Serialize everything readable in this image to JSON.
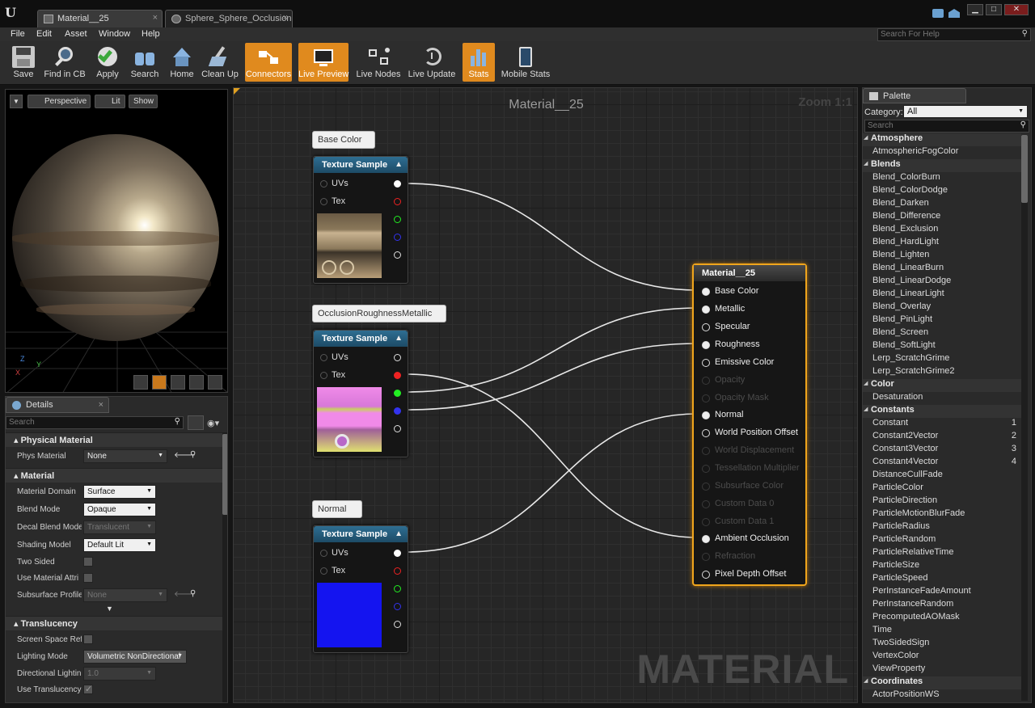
{
  "window": {
    "tabs": [
      {
        "label": "Material__25",
        "close": "×"
      },
      {
        "label": "Sphere_Sphere_OcclusionR",
        "close": "×"
      }
    ],
    "buttons": {
      "minimize": "▁",
      "maximize": "□",
      "close": "✕"
    },
    "logo": "U"
  },
  "menu": {
    "items": [
      "File",
      "Edit",
      "Asset",
      "Window",
      "Help"
    ],
    "search_placeholder": "Search For Help"
  },
  "toolbar": {
    "buttons": [
      {
        "label": "Save",
        "icon": "save-icon",
        "active": false
      },
      {
        "label": "Find in CB",
        "icon": "magnifier-icon",
        "active": false
      },
      {
        "label": "Apply",
        "icon": "checkmark-icon",
        "active": false
      },
      {
        "label": "Search",
        "icon": "binoculars-icon",
        "active": false
      },
      {
        "label": "Home",
        "icon": "home-icon",
        "active": false
      },
      {
        "label": "Clean Up",
        "icon": "broom-icon",
        "active": false
      },
      {
        "label": "Connectors",
        "icon": "connectors-icon",
        "active": true
      },
      {
        "label": "Live Preview",
        "icon": "monitor-icon",
        "active": true
      },
      {
        "label": "Live Nodes",
        "icon": "nodes-icon",
        "active": false
      },
      {
        "label": "Live Update",
        "icon": "refresh-clock-icon",
        "active": false
      },
      {
        "label": "Stats",
        "icon": "bars-icon",
        "active": true
      },
      {
        "label": "Mobile Stats",
        "icon": "mobile-icon",
        "active": false
      }
    ]
  },
  "viewport": {
    "perspective": "Perspective",
    "lit": "Lit",
    "show": "Show",
    "axis_z": "Z",
    "axis_y": "Y",
    "axis_x": "X"
  },
  "details": {
    "tab": "Details",
    "search_placeholder": "Search",
    "close": "×",
    "sections": {
      "physical": {
        "title": "Physical Material",
        "rows": [
          {
            "label": "Phys Material",
            "value": "None"
          }
        ]
      },
      "material": {
        "title": "Material",
        "rows": [
          {
            "label": "Material Domain",
            "value": "Surface"
          },
          {
            "label": "Blend Mode",
            "value": "Opaque"
          },
          {
            "label": "Decal Blend Mode",
            "value": "Translucent"
          },
          {
            "label": "Shading Model",
            "value": "Default Lit"
          },
          {
            "label": "Two Sided",
            "checked": false
          },
          {
            "label": "Use Material Attri",
            "checked": false
          },
          {
            "label": "Subsurface Profile",
            "value": "None"
          }
        ]
      },
      "translucency": {
        "title": "Translucency",
        "rows": [
          {
            "label": "Screen Space Ref",
            "checked": false
          },
          {
            "label": "Lighting Mode",
            "value": "Volumetric NonDirectional"
          },
          {
            "label": "Directional Lightin",
            "value": "1.0"
          },
          {
            "label": "Use Translucency",
            "checked": true
          }
        ]
      }
    }
  },
  "graph": {
    "title": "Material__25",
    "zoom": "Zoom 1:1",
    "watermark": "MATERIAL",
    "comments": [
      "Base Color",
      "OcclusionRoughnessMetallic",
      "Normal"
    ],
    "texture_nodes": [
      {
        "title": "Texture Sample",
        "inputs": [
          "UVs",
          "Tex"
        ]
      },
      {
        "title": "Texture Sample",
        "inputs": [
          "UVs",
          "Tex"
        ]
      },
      {
        "title": "Texture Sample",
        "inputs": [
          "UVs",
          "Tex"
        ]
      }
    ],
    "material_node": {
      "title": "Material__25",
      "pins": [
        {
          "label": "Base Color",
          "state": "connected"
        },
        {
          "label": "Metallic",
          "state": "connected"
        },
        {
          "label": "Specular",
          "state": "open"
        },
        {
          "label": "Roughness",
          "state": "connected"
        },
        {
          "label": "Emissive Color",
          "state": "open"
        },
        {
          "label": "Opacity",
          "state": "disabled"
        },
        {
          "label": "Opacity Mask",
          "state": "disabled"
        },
        {
          "label": "Normal",
          "state": "connected"
        },
        {
          "label": "World Position Offset",
          "state": "open"
        },
        {
          "label": "World Displacement",
          "state": "disabled"
        },
        {
          "label": "Tessellation Multiplier",
          "state": "disabled"
        },
        {
          "label": "Subsurface Color",
          "state": "disabled"
        },
        {
          "label": "Custom Data 0",
          "state": "disabled"
        },
        {
          "label": "Custom Data 1",
          "state": "disabled"
        },
        {
          "label": "Ambient Occlusion",
          "state": "connected"
        },
        {
          "label": "Refraction",
          "state": "disabled"
        },
        {
          "label": "Pixel Depth Offset",
          "state": "open"
        }
      ]
    }
  },
  "palette": {
    "tab": "Palette",
    "category_label": "Category:",
    "category_value": "All",
    "search_placeholder": "Search",
    "items": [
      {
        "t": "h",
        "label": "Atmosphere"
      },
      {
        "t": "i",
        "label": "AtmosphericFogColor"
      },
      {
        "t": "h",
        "label": "Blends"
      },
      {
        "t": "i",
        "label": "Blend_ColorBurn"
      },
      {
        "t": "i",
        "label": "Blend_ColorDodge"
      },
      {
        "t": "i",
        "label": "Blend_Darken"
      },
      {
        "t": "i",
        "label": "Blend_Difference"
      },
      {
        "t": "i",
        "label": "Blend_Exclusion"
      },
      {
        "t": "i",
        "label": "Blend_HardLight"
      },
      {
        "t": "i",
        "label": "Blend_Lighten"
      },
      {
        "t": "i",
        "label": "Blend_LinearBurn"
      },
      {
        "t": "i",
        "label": "Blend_LinearDodge"
      },
      {
        "t": "i",
        "label": "Blend_LinearLight"
      },
      {
        "t": "i",
        "label": "Blend_Overlay"
      },
      {
        "t": "i",
        "label": "Blend_PinLight"
      },
      {
        "t": "i",
        "label": "Blend_Screen"
      },
      {
        "t": "i",
        "label": "Blend_SoftLight"
      },
      {
        "t": "i",
        "label": "Lerp_ScratchGrime"
      },
      {
        "t": "i",
        "label": "Lerp_ScratchGrime2"
      },
      {
        "t": "h",
        "label": "Color"
      },
      {
        "t": "i",
        "label": "Desaturation"
      },
      {
        "t": "h",
        "label": "Constants"
      },
      {
        "t": "i",
        "label": "Constant",
        "n": "1"
      },
      {
        "t": "i",
        "label": "Constant2Vector",
        "n": "2"
      },
      {
        "t": "i",
        "label": "Constant3Vector",
        "n": "3"
      },
      {
        "t": "i",
        "label": "Constant4Vector",
        "n": "4"
      },
      {
        "t": "i",
        "label": "DistanceCullFade"
      },
      {
        "t": "i",
        "label": "ParticleColor"
      },
      {
        "t": "i",
        "label": "ParticleDirection"
      },
      {
        "t": "i",
        "label": "ParticleMotionBlurFade"
      },
      {
        "t": "i",
        "label": "ParticleRadius"
      },
      {
        "t": "i",
        "label": "ParticleRandom"
      },
      {
        "t": "i",
        "label": "ParticleRelativeTime"
      },
      {
        "t": "i",
        "label": "ParticleSize"
      },
      {
        "t": "i",
        "label": "ParticleSpeed"
      },
      {
        "t": "i",
        "label": "PerInstanceFadeAmount"
      },
      {
        "t": "i",
        "label": "PerInstanceRandom"
      },
      {
        "t": "i",
        "label": "PrecomputedAOMask"
      },
      {
        "t": "i",
        "label": "Time"
      },
      {
        "t": "i",
        "label": "TwoSidedSign"
      },
      {
        "t": "i",
        "label": "VertexColor"
      },
      {
        "t": "i",
        "label": "ViewProperty"
      },
      {
        "t": "h",
        "label": "Coordinates"
      },
      {
        "t": "i",
        "label": "ActorPositionWS"
      }
    ]
  },
  "colors": {
    "accent": "#e08a1e",
    "node_header": "#2e6e92",
    "material_border": "#f0a51c"
  }
}
